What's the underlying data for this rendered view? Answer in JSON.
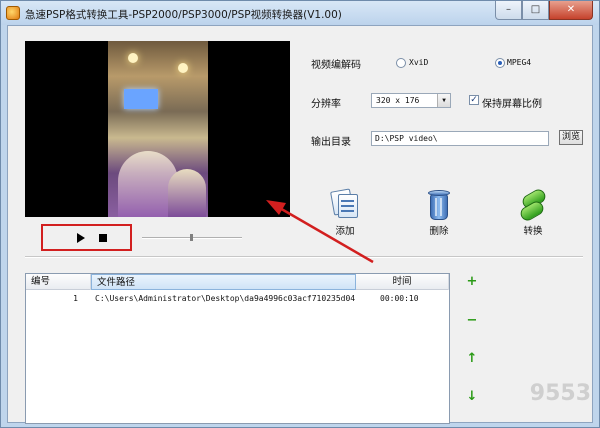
{
  "window": {
    "title": "急速PSP格式转换工具-PSP2000/PSP3000/PSP视频转换器(V1.00)",
    "controls": {
      "minimize": "–",
      "maximize": "□",
      "close": "✕"
    }
  },
  "player": {
    "play_icon": "play-icon",
    "stop_icon": "stop-icon",
    "seek_position": 0.5
  },
  "settings": {
    "codec_label": "视频编解码",
    "codec_options": [
      {
        "label": "XviD",
        "selected": false
      },
      {
        "label": "MPEG4",
        "selected": true
      }
    ],
    "resolution_label": "分辨率",
    "resolution_value": "320 x 176",
    "keep_ratio_label": "保持屏幕比例",
    "keep_ratio_checked": true,
    "output_label": "输出目录",
    "output_value": "D:\\PSP video\\",
    "browse_label": "浏览"
  },
  "actions": {
    "add_label": "添加",
    "delete_label": "删除",
    "convert_label": "转换"
  },
  "file_list": {
    "columns": [
      "编号",
      "文件路径",
      "时间"
    ],
    "rows": [
      {
        "index": "1",
        "path": "C:\\Users\\Administrator\\Desktop\\da9a4996c03acf710235d04e...",
        "time": "00:00:10"
      }
    ]
  },
  "list_buttons": {
    "add": "+",
    "remove": "−",
    "up": "↑",
    "down": "↓"
  },
  "colors": {
    "highlight_red": "#d21f1f",
    "list_button_green": "#2a9a16",
    "titlebar": "#bcd3ec"
  },
  "watermark": "9553"
}
